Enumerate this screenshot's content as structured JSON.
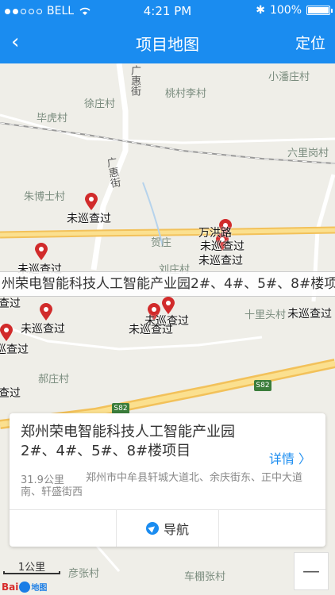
{
  "status": {
    "carrier": "BELL",
    "time": "4:21 PM",
    "battery": "100%"
  },
  "nav": {
    "back": "‹",
    "title": "项目地图",
    "locate": "定位"
  },
  "map": {
    "places": [
      {
        "name": "小潘庄村"
      },
      {
        "name": "桃村李村"
      },
      {
        "name": "徐庄村"
      },
      {
        "name": "毕虎村"
      },
      {
        "name": "六里岗村"
      },
      {
        "name": "朱博士村"
      },
      {
        "name": "贺庄"
      },
      {
        "name": "刘庄村"
      },
      {
        "name": "十里头村"
      },
      {
        "name": "郝庄村"
      },
      {
        "name": "彦张村"
      },
      {
        "name": "车棚张村"
      }
    ],
    "roads": [
      "广惠街",
      "广惠街"
    ],
    "highway": "S82",
    "pin_labels": [
      "未巡查过",
      "万洪路",
      "未巡查过",
      "未巡查过",
      "未巡查过",
      "未巡查过",
      "未巡查过",
      "未巡查过",
      "未巡查过",
      "未巡查过",
      "未巡查过",
      "未巡查过"
    ],
    "tip": "州荣电智能科技人工智能产业园2#、4#、5#、8#楼项"
  },
  "card": {
    "title": "郑州荣电智能科技人工智能产业园2#、4#、5#、8#楼项目",
    "detail": "详情 〉",
    "distance": "31.9公里",
    "address": "郑州市中牟县轩城大道北、余庆街东、正中大道南、轩盛街西",
    "nav_label": "导航"
  },
  "controls": {
    "zoom_out": "—",
    "scale": "1公里",
    "logo_brand": "Bai",
    "logo_map": "地图"
  },
  "colors": {
    "primary": "#1a8cf0",
    "pin": "#d12b2b",
    "highway": "#f2c15a"
  }
}
